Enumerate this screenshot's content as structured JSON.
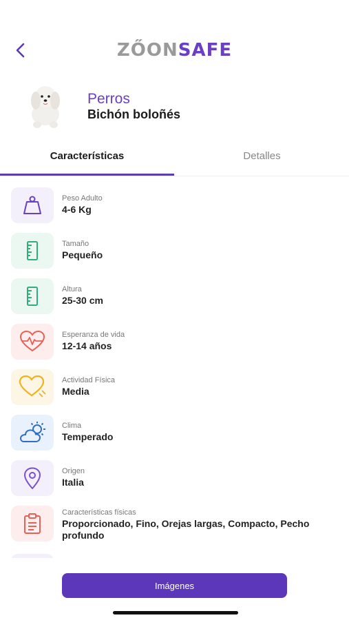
{
  "header": {
    "logo_part1": "ZŐON",
    "logo_part2": "SAFE"
  },
  "breed": {
    "category": "Perros",
    "name": "Bichón boloñés"
  },
  "tabs": [
    {
      "label": "Características"
    },
    {
      "label": "Detalles"
    }
  ],
  "items": [
    {
      "label": "Peso Adulto",
      "value": "4-6 Kg",
      "icon": "weight-icon",
      "color": "#6b3fc4",
      "bg": "#f3effb"
    },
    {
      "label": "Tamaño",
      "value": "Pequeño",
      "icon": "ruler-icon",
      "color": "#2fae7a",
      "bg": "#eaf8f1"
    },
    {
      "label": "Altura",
      "value": "25-30 cm",
      "icon": "ruler-icon",
      "color": "#2fae7a",
      "bg": "#eaf8f1"
    },
    {
      "label": "Esperanza de vida",
      "value": "12-14 años",
      "icon": "heartbeat-icon",
      "color": "#e85f55",
      "bg": "#fdeeed"
    },
    {
      "label": "Actividad Física",
      "value": "Media",
      "icon": "heart-icon",
      "color": "#f0b21d",
      "bg": "#fef6e4"
    },
    {
      "label": "Clima",
      "value": "Temperado",
      "icon": "weather-icon",
      "color": "#2f6ec7",
      "bg": "#e9f2fc"
    },
    {
      "label": "Origen",
      "value": "Italia",
      "icon": "location-icon",
      "color": "#7b4fd0",
      "bg": "#f3effb"
    },
    {
      "label": "Características físicas",
      "value": "Proporcionado, Fino, Orejas largas, Compacto, Pecho profundo",
      "icon": "clipboard-icon",
      "color": "#e85f55",
      "bg": "#fdeeed"
    }
  ],
  "button": {
    "label": "Imágenes"
  }
}
